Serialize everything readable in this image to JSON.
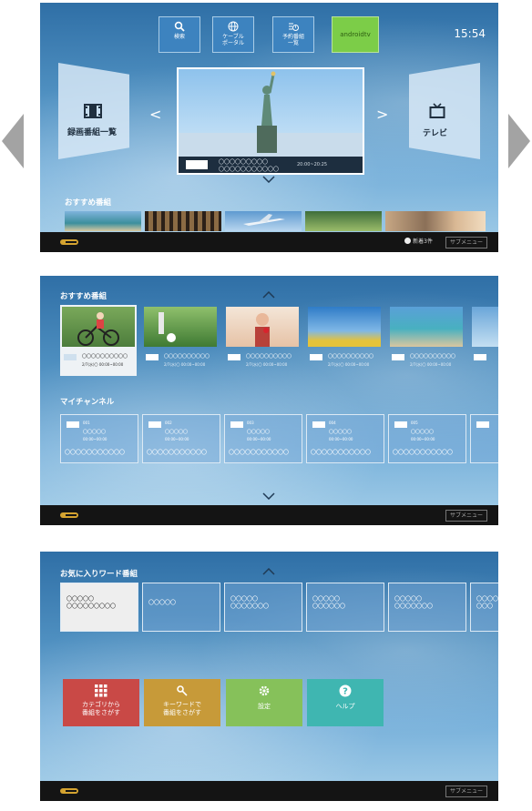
{
  "colors": {
    "accent": "#3d83bf",
    "android": "#7ccd48",
    "category_tile": "#c94946",
    "keyword_tile": "#c79a39",
    "settings_tile": "#86c15a",
    "help_tile": "#3fb6b1"
  },
  "screen1": {
    "top_buttons": [
      {
        "label": "検索",
        "icon": "search-icon"
      },
      {
        "label": "ケーブル\nポータル",
        "icon": "globe-icon"
      },
      {
        "label": "予約番組\n一覧",
        "icon": "schedule-icon"
      }
    ],
    "androidtv_label": "androidtv",
    "clock": "15:54",
    "left_panel": {
      "label": "録画番組一覧",
      "icon": "film-icon"
    },
    "right_panel": {
      "label": "テレビ",
      "icon": "tv-icon"
    },
    "featured": {
      "line1": "〇〇〇〇〇〇〇〇〇",
      "line2": "〇〇〇〇〇〇〇〇〇〇〇",
      "time": "20:00~20:25"
    },
    "section_title": "おすすめ番組",
    "new_recordings": "新着3件",
    "submenu": "サブメニュー"
  },
  "screen2": {
    "recommend_title": "おすすめ番組",
    "recommend_items": [
      {
        "line1": "〇〇〇〇〇〇〇〇〇〇",
        "line2": "2/7(水)〇 00:00~00:00"
      },
      {
        "line1": "〇〇〇〇〇〇〇〇〇〇",
        "line2": "2/7(水)〇 00:00~00:00"
      },
      {
        "line1": "〇〇〇〇〇〇〇〇〇〇",
        "line2": "2/7(水)〇 00:00~00:00"
      },
      {
        "line1": "〇〇〇〇〇〇〇〇〇〇",
        "line2": "2/7(水)〇 00:00~00:00"
      },
      {
        "line1": "〇〇〇〇〇〇〇〇〇〇",
        "line2": "2/7(水)〇 00:00~00:00"
      }
    ],
    "channel_title": "マイチャンネル",
    "channel_items": [
      {
        "num": "001",
        "name": "〇〇〇〇〇",
        "time": "00:00~00:00",
        "prog": "〇〇〇〇〇〇〇〇〇〇〇"
      },
      {
        "num": "002",
        "name": "〇〇〇〇〇",
        "time": "00:00~00:00",
        "prog": "〇〇〇〇〇〇〇〇〇〇〇"
      },
      {
        "num": "003",
        "name": "〇〇〇〇〇",
        "time": "00:00~00:00",
        "prog": "〇〇〇〇〇〇〇〇〇〇〇"
      },
      {
        "num": "004",
        "name": "〇〇〇〇〇",
        "time": "00:00~00:00",
        "prog": "〇〇〇〇〇〇〇〇〇〇〇"
      },
      {
        "num": "005",
        "name": "〇〇〇〇〇",
        "time": "00:00~00:00",
        "prog": "〇〇〇〇〇〇〇〇〇〇〇"
      }
    ],
    "submenu": "サブメニュー"
  },
  "screen3": {
    "title": "お気に入りワード番組",
    "keyword_items": [
      {
        "line1": "〇〇〇〇〇",
        "line2": "〇〇〇〇〇〇〇〇〇"
      },
      {
        "line1": "〇〇〇〇〇",
        "line2": ""
      },
      {
        "line1": "〇〇〇〇〇",
        "line2": "〇〇〇〇〇〇〇"
      },
      {
        "line1": "〇〇〇〇〇",
        "line2": "〇〇〇〇〇〇"
      },
      {
        "line1": "〇〇〇〇〇",
        "line2": "〇〇〇〇〇〇〇"
      },
      {
        "line1": "〇〇〇〇",
        "line2": "〇〇〇"
      }
    ],
    "tiles": [
      {
        "line1": "カテゴリから",
        "line2": "番組をさがす",
        "icon": "grid-icon"
      },
      {
        "line1": "キーワードで",
        "line2": "番組をさがす",
        "icon": "key-icon"
      },
      {
        "line1": "設定",
        "line2": "",
        "icon": "gear-icon"
      },
      {
        "line1": "ヘルプ",
        "line2": "",
        "icon": "help-icon"
      }
    ],
    "submenu": "サブメニュー"
  }
}
